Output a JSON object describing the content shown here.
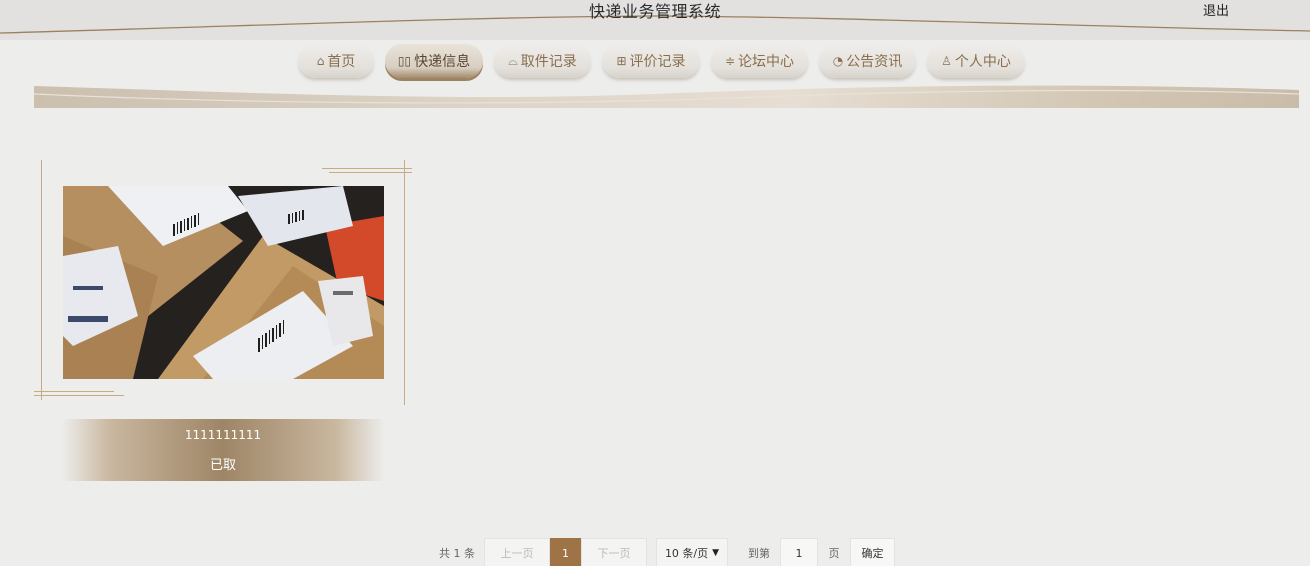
{
  "header": {
    "title": "快递业务管理系统",
    "logout_label": "退出"
  },
  "nav": {
    "items": [
      {
        "label": "首页",
        "icon": "home-icon",
        "glyph": "⌂"
      },
      {
        "label": "快递信息",
        "icon": "book-open-icon",
        "glyph": "▯▯"
      },
      {
        "label": "取件记录",
        "icon": "reading-icon",
        "glyph": "⌓"
      },
      {
        "label": "评价记录",
        "icon": "gift-icon",
        "glyph": "⊞"
      },
      {
        "label": "论坛中心",
        "icon": "sliders-icon",
        "glyph": "≑"
      },
      {
        "label": "公告资讯",
        "icon": "dashboard-icon",
        "glyph": "◔"
      },
      {
        "label": "个人中心",
        "icon": "user-icon",
        "glyph": "♙"
      }
    ],
    "active_index": 1
  },
  "card": {
    "number": "1111111111",
    "status": "已取",
    "image_alt": "package parcels photo"
  },
  "pagination": {
    "total_text": "共 1 条",
    "prev_label": "上一页",
    "current_page": "1",
    "next_label": "下一页",
    "page_size_label": "10 条/页",
    "goto_label": "到第",
    "goto_value": "1",
    "page_unit": "页",
    "confirm_label": "确定"
  },
  "colors": {
    "accent": "#9e7446",
    "nav_text": "#8a6e4e",
    "background": "#ededec"
  }
}
